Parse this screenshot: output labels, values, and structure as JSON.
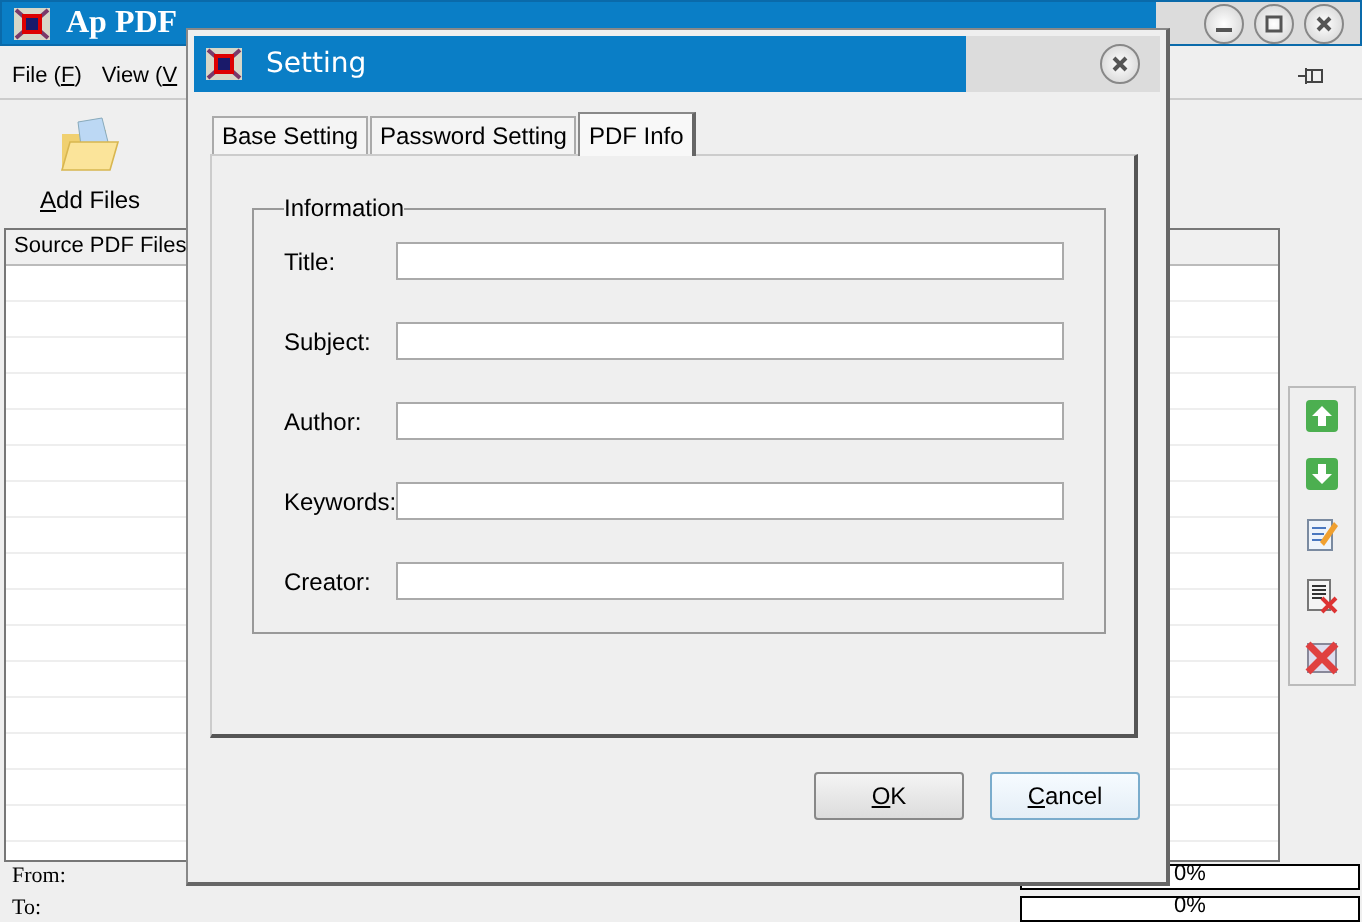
{
  "window": {
    "title": "Ap PDF"
  },
  "menu": [
    {
      "before": "File (",
      "mnemonic": "F",
      "after": ")"
    },
    {
      "before": "View (",
      "mnemonic": "V"
    }
  ],
  "toolbar": [
    {
      "mnemonic": "A",
      "after": "dd Files"
    }
  ],
  "list": {
    "columns": [
      "Source PDF Files"
    ]
  },
  "side_tools": [
    {
      "kind": "up"
    },
    {
      "kind": "down"
    },
    {
      "kind": "edit"
    },
    {
      "kind": "remove"
    },
    {
      "kind": "clear"
    }
  ],
  "status": [
    {
      "label": "From:",
      "level": 0,
      "reading": "0%"
    },
    {
      "label": "To:",
      "level": 0,
      "reading": "0%"
    }
  ],
  "dialog": {
    "title": "Setting",
    "tabs": [
      {
        "label": "Base Setting",
        "selected": false
      },
      {
        "label": "Password Setting",
        "selected": false
      },
      {
        "label": "PDF Info",
        "selected": true
      }
    ],
    "group": "Information",
    "fields": [
      {
        "label": "Title:"
      },
      {
        "label": "Subject:"
      },
      {
        "label": "Author:"
      },
      {
        "label": "Keywords:"
      },
      {
        "label": "Creator:"
      }
    ],
    "buttons": [
      {
        "mnemonic": "O",
        "after": "K",
        "default": false
      },
      {
        "mnemonic": "C",
        "after": "ancel",
        "default": true
      }
    ]
  }
}
